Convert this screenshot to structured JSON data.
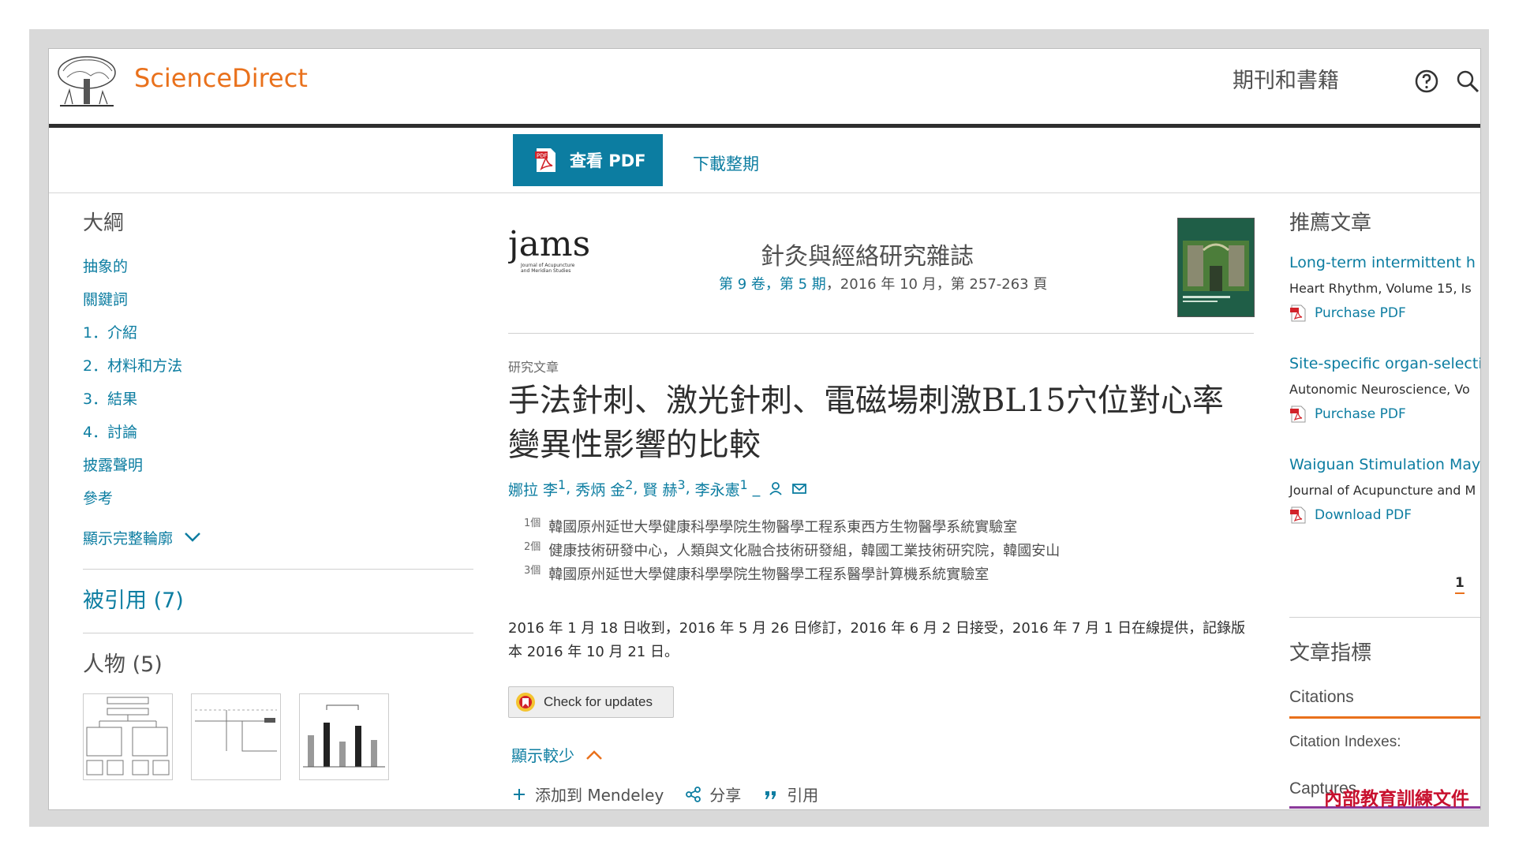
{
  "header": {
    "brand": "ScienceDirect",
    "journals_books": "期刊和書籍",
    "brand_color": "#e9711c",
    "icons": [
      "tree-logo-icon",
      "help-icon",
      "search-icon"
    ]
  },
  "toolbar": {
    "view_pdf": "查看 PDF",
    "download_issue": "下載整期",
    "accent": "#0c7da1"
  },
  "outline": {
    "title": "大綱",
    "items": [
      "抽象的",
      "關鍵詞",
      "1．介紹",
      "2．材料和方法",
      "3．結果",
      "4．討論",
      "披露聲明",
      "參考"
    ],
    "show_full": "顯示完整輪廓",
    "cited_by": "被引用 (7)",
    "figures": "人物 (5)"
  },
  "article": {
    "journal_logo_text": "jams",
    "journal_logo_sub": "Journal of Acupuncture and Meridian Studies",
    "journal_name": "針灸與經絡研究雜誌",
    "volume": "第 9 卷",
    "issue": "第 5 期",
    "issue_rest": "，2016 年 10 月，第 257-263 頁",
    "type": "研究文章",
    "title": "手法針刺、激光針刺、電磁場刺激BL15穴位對心率變異性影響的比較",
    "authors": [
      {
        "name": "娜拉 李",
        "sup": "1"
      },
      {
        "name": "秀炳 金",
        "sup": "2"
      },
      {
        "name": "賢 赫",
        "sup": "3"
      },
      {
        "name": "李永憲",
        "sup": "1"
      }
    ],
    "affiliations": [
      {
        "mark": "1個",
        "text": "韓國原州延世大學健康科學學院生物醫學工程系東西方生物醫學系統實驗室"
      },
      {
        "mark": "2個",
        "text": "健康技術研發中心，人類與文化融合技術研發組，韓國工業技術研究院，韓國安山"
      },
      {
        "mark": "3個",
        "text": "韓國原州延世大學健康科學學院生物醫學工程系醫學計算機系統實驗室"
      }
    ],
    "history": "2016 年 1 月 18 日收到，2016 年 5 月 26 日修訂，2016 年 6 月 2 日接受，2016 年 7 月 1 日在線提供，記錄版本 2016 年 10 月 21 日。",
    "check_updates": "Check for updates",
    "show_less": "顯示較少",
    "add_mendeley": "添加到 Mendeley",
    "share": "分享",
    "cite": "引用"
  },
  "recommended": {
    "title": "推薦文章",
    "items": [
      {
        "title": "Long-term intermittent h",
        "source": "Heart Rhythm, Volume 15, Is",
        "action": "Purchase PDF"
      },
      {
        "title": "Site-specific organ-selecti",
        "source": "Autonomic Neuroscience, Vo",
        "action": "Purchase PDF"
      },
      {
        "title": "Waiguan Stimulation May",
        "source": "Journal of Acupuncture and M",
        "action": "Download PDF"
      }
    ],
    "page": "1"
  },
  "metrics": {
    "title": "文章指標",
    "citations": "Citations",
    "citation_indexes": "Citation Indexes:",
    "captures": "Captures"
  },
  "watermark": "內部教育訓練文件"
}
